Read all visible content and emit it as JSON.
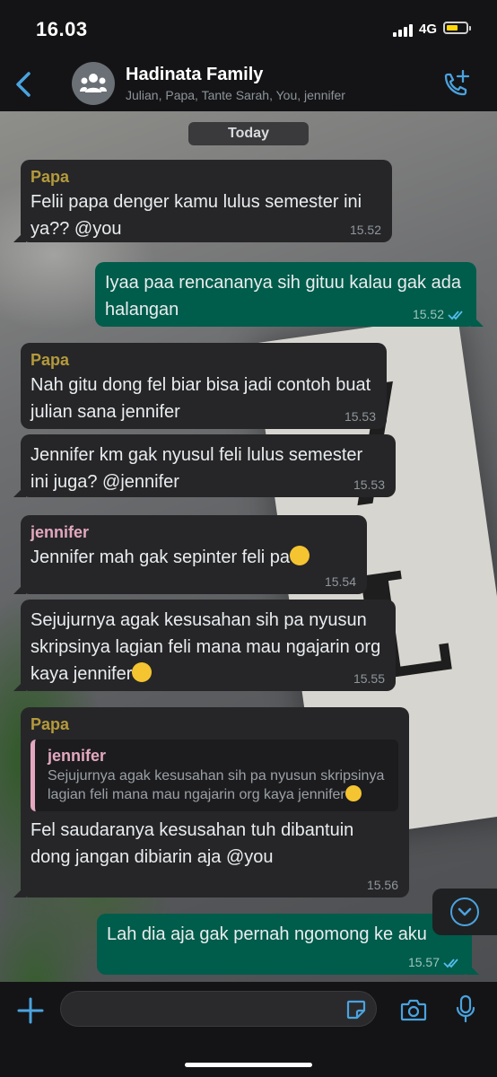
{
  "status": {
    "time": "16.03",
    "network": "4G"
  },
  "header": {
    "title": "Hadinata Family",
    "participants": "Julian, Papa, Tante Sarah, You, jennifer"
  },
  "chat": {
    "date_label": "Today",
    "messages": [
      {
        "from": "Papa",
        "text": "Felii papa denger kamu lulus semester ini ya?? @you",
        "time": "15.52"
      },
      {
        "text": "Iyaa paa rencananya sih gituu kalau gak ada halangan",
        "time": "15.52"
      },
      {
        "from": "Papa",
        "text": "Nah gitu dong fel biar bisa jadi contoh buat julian sana jennifer",
        "time": "15.53"
      },
      {
        "text": "Jennifer km gak nyusul feli lulus semester ini juga? @jennifer",
        "time": "15.53"
      },
      {
        "from": "jennifer",
        "text": "Jennifer mah gak sepinter feli pa",
        "time": "15.54"
      },
      {
        "text": "Sejujurnya agak kesusahan sih pa nyusun skripsinya lagian feli mana mau ngajarin org kaya jennifer",
        "time": "15.55"
      },
      {
        "from": "Papa",
        "quote_name": "jennifer",
        "quote_text": "Sejujurnya agak kesusahan sih pa nyusun skripsinya lagian feli mana mau ngajarin org kaya jennifer",
        "text": "Fel saudaranya kesusahan tuh dibantuin dong jangan dibiarin aja @you",
        "time": "15.56"
      },
      {
        "text": "Lah dia aja gak pernah ngomong ke aku",
        "time": "15.57"
      }
    ]
  },
  "icons": {
    "back": "chevron-left-icon",
    "call": "add-call-icon",
    "group_avatar": "group-icon",
    "scroll": "scroll-down-icon",
    "attach": "plus-icon",
    "sticker": "sticker-icon",
    "camera": "camera-icon",
    "mic": "microphone-icon"
  },
  "colors": {
    "accent": "#4aa3df",
    "incoming": "#262628",
    "outgoing": "#005c4b",
    "papa_name": "#b49a3c",
    "jennifer_name": "#e3a8bf"
  }
}
